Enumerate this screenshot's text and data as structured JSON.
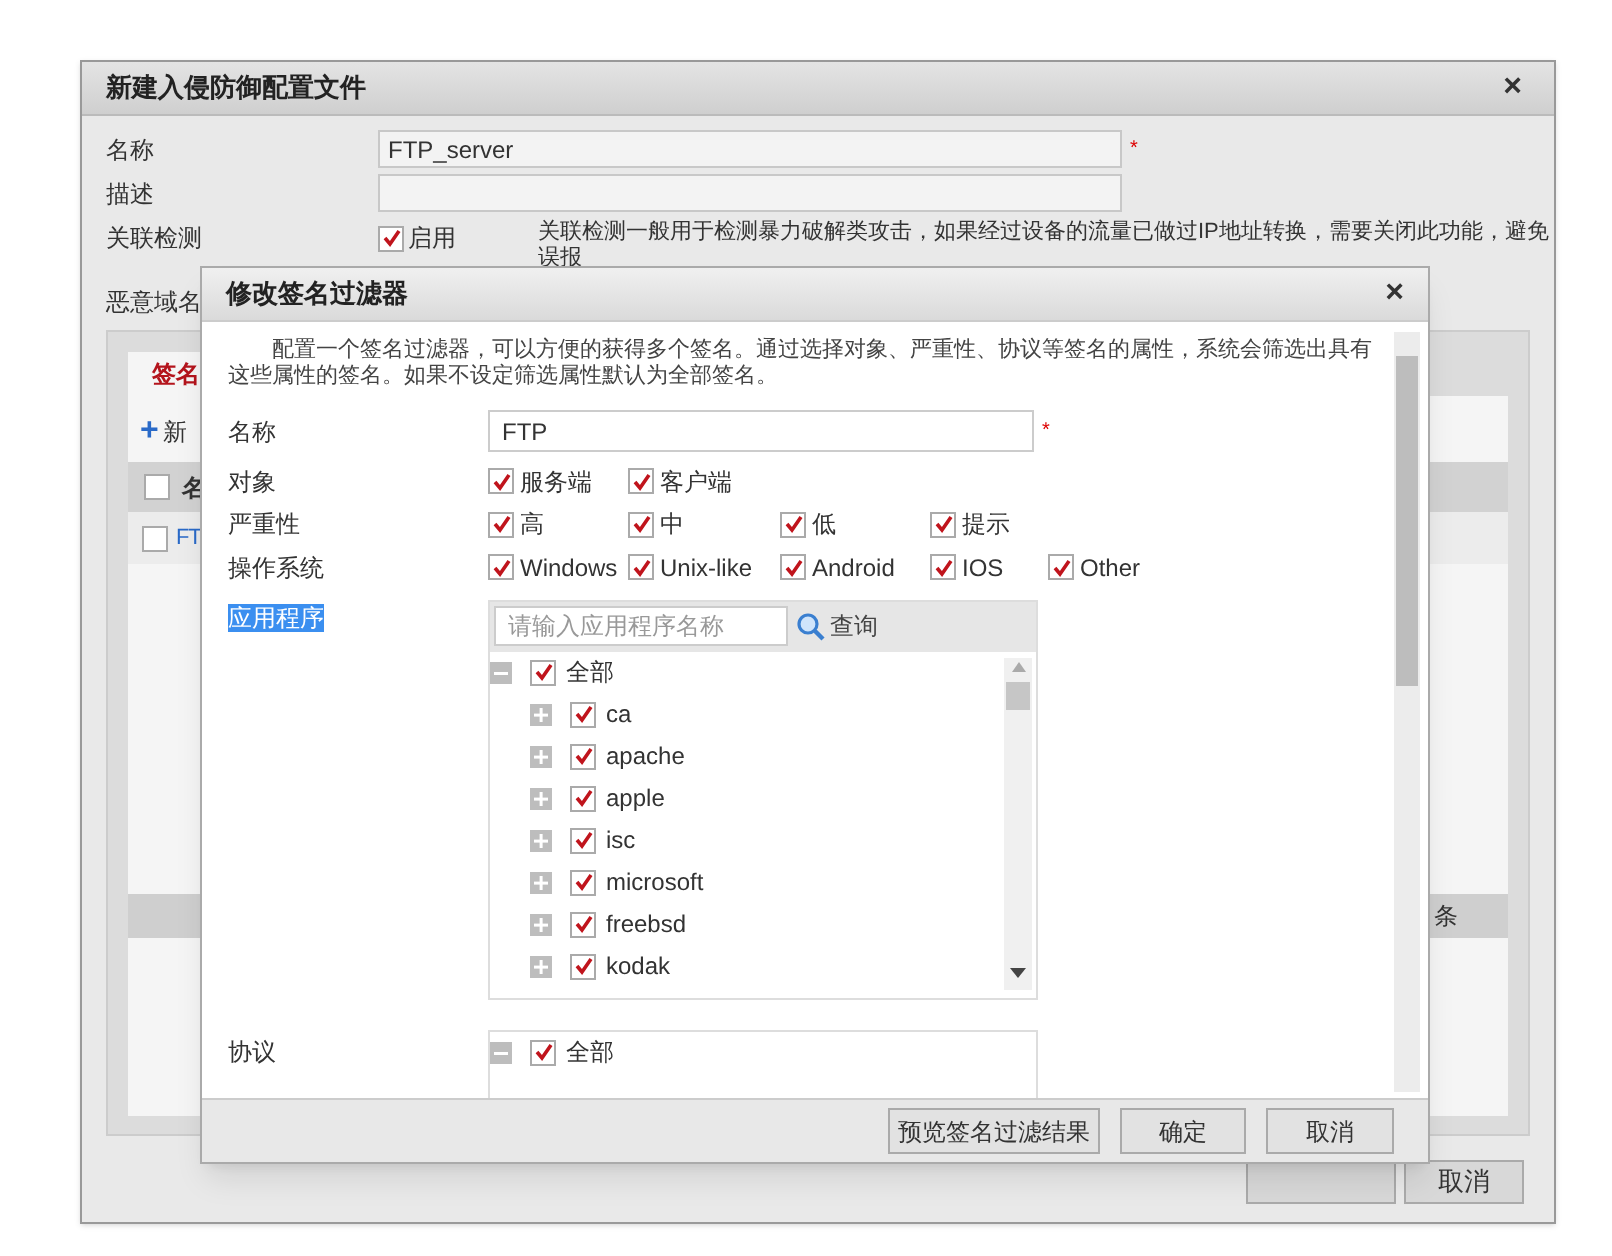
{
  "background_dialog": {
    "title": "新建入侵防御配置文件",
    "close": "×",
    "name_field": {
      "label": "名称",
      "value": "FTP_server",
      "required_mark": "*"
    },
    "description_field": {
      "label": "描述"
    },
    "correlation": {
      "label": "关联检测",
      "option": "启用",
      "checked": true,
      "note": "关联检测一般用于检测暴力破解类攻击，如果经过设备的流量已做过IP地址转换，需要关闭此功能，避免",
      "note_cont": "误报"
    },
    "malicious_domain_label": "恶意域名",
    "tab": {
      "label": "签名",
      "selected": true
    },
    "new_button": "新",
    "new_button_icon": "+",
    "table": {
      "header": "名",
      "rows": [
        {
          "cell": "FT",
          "checked": false
        }
      ],
      "header_checked": false
    },
    "pager": "条",
    "cancel_button": "取消"
  },
  "modal": {
    "title": "修改签名过滤器",
    "close": "×",
    "intro": "配置一个签名过滤器，可以方便的获得多个签名。通过选择对象、严重性、协议等签名的属性，系统会筛选出具有这些属性的签名。如果不设定筛选属性默认为全部签名。",
    "name_field": {
      "label": "名称",
      "value": "FTP",
      "required_mark": "*"
    },
    "option_rows": [
      {
        "label": "对象",
        "options": [
          {
            "label": "服务端",
            "checked": true
          },
          {
            "label": "客户端",
            "checked": true
          }
        ]
      },
      {
        "label": "严重性",
        "options": [
          {
            "label": "高",
            "checked": true
          },
          {
            "label": "中",
            "checked": true
          },
          {
            "label": "低",
            "checked": true
          },
          {
            "label": "提示",
            "checked": true
          }
        ]
      },
      {
        "label": "操作系统",
        "options": [
          {
            "label": "Windows",
            "checked": true
          },
          {
            "label": "Unix-like",
            "checked": true
          },
          {
            "label": "Android",
            "checked": true
          },
          {
            "label": "IOS",
            "checked": true
          },
          {
            "label": "Other",
            "checked": true
          }
        ]
      }
    ],
    "applications": {
      "label": "应用程序",
      "selected": true,
      "search_placeholder": "请输入应用程序名称",
      "search_button": "查询",
      "tree": [
        {
          "label": "全部",
          "checked": true,
          "expanded": true,
          "children": [
            {
              "label": "ca",
              "checked": true,
              "expanded": false
            },
            {
              "label": "apache",
              "checked": true,
              "expanded": false
            },
            {
              "label": "apple",
              "checked": true,
              "expanded": false
            },
            {
              "label": "isc",
              "checked": true,
              "expanded": false
            },
            {
              "label": "microsoft",
              "checked": true,
              "expanded": false
            },
            {
              "label": "freebsd",
              "checked": true,
              "expanded": false
            },
            {
              "label": "kodak",
              "checked": true,
              "expanded": false
            }
          ]
        }
      ]
    },
    "protocols": {
      "label": "协议",
      "tree": [
        {
          "label": "全部",
          "checked": true,
          "expanded": true
        }
      ]
    },
    "buttons": [
      "预览签名过滤结果",
      "确定",
      "取消"
    ]
  }
}
